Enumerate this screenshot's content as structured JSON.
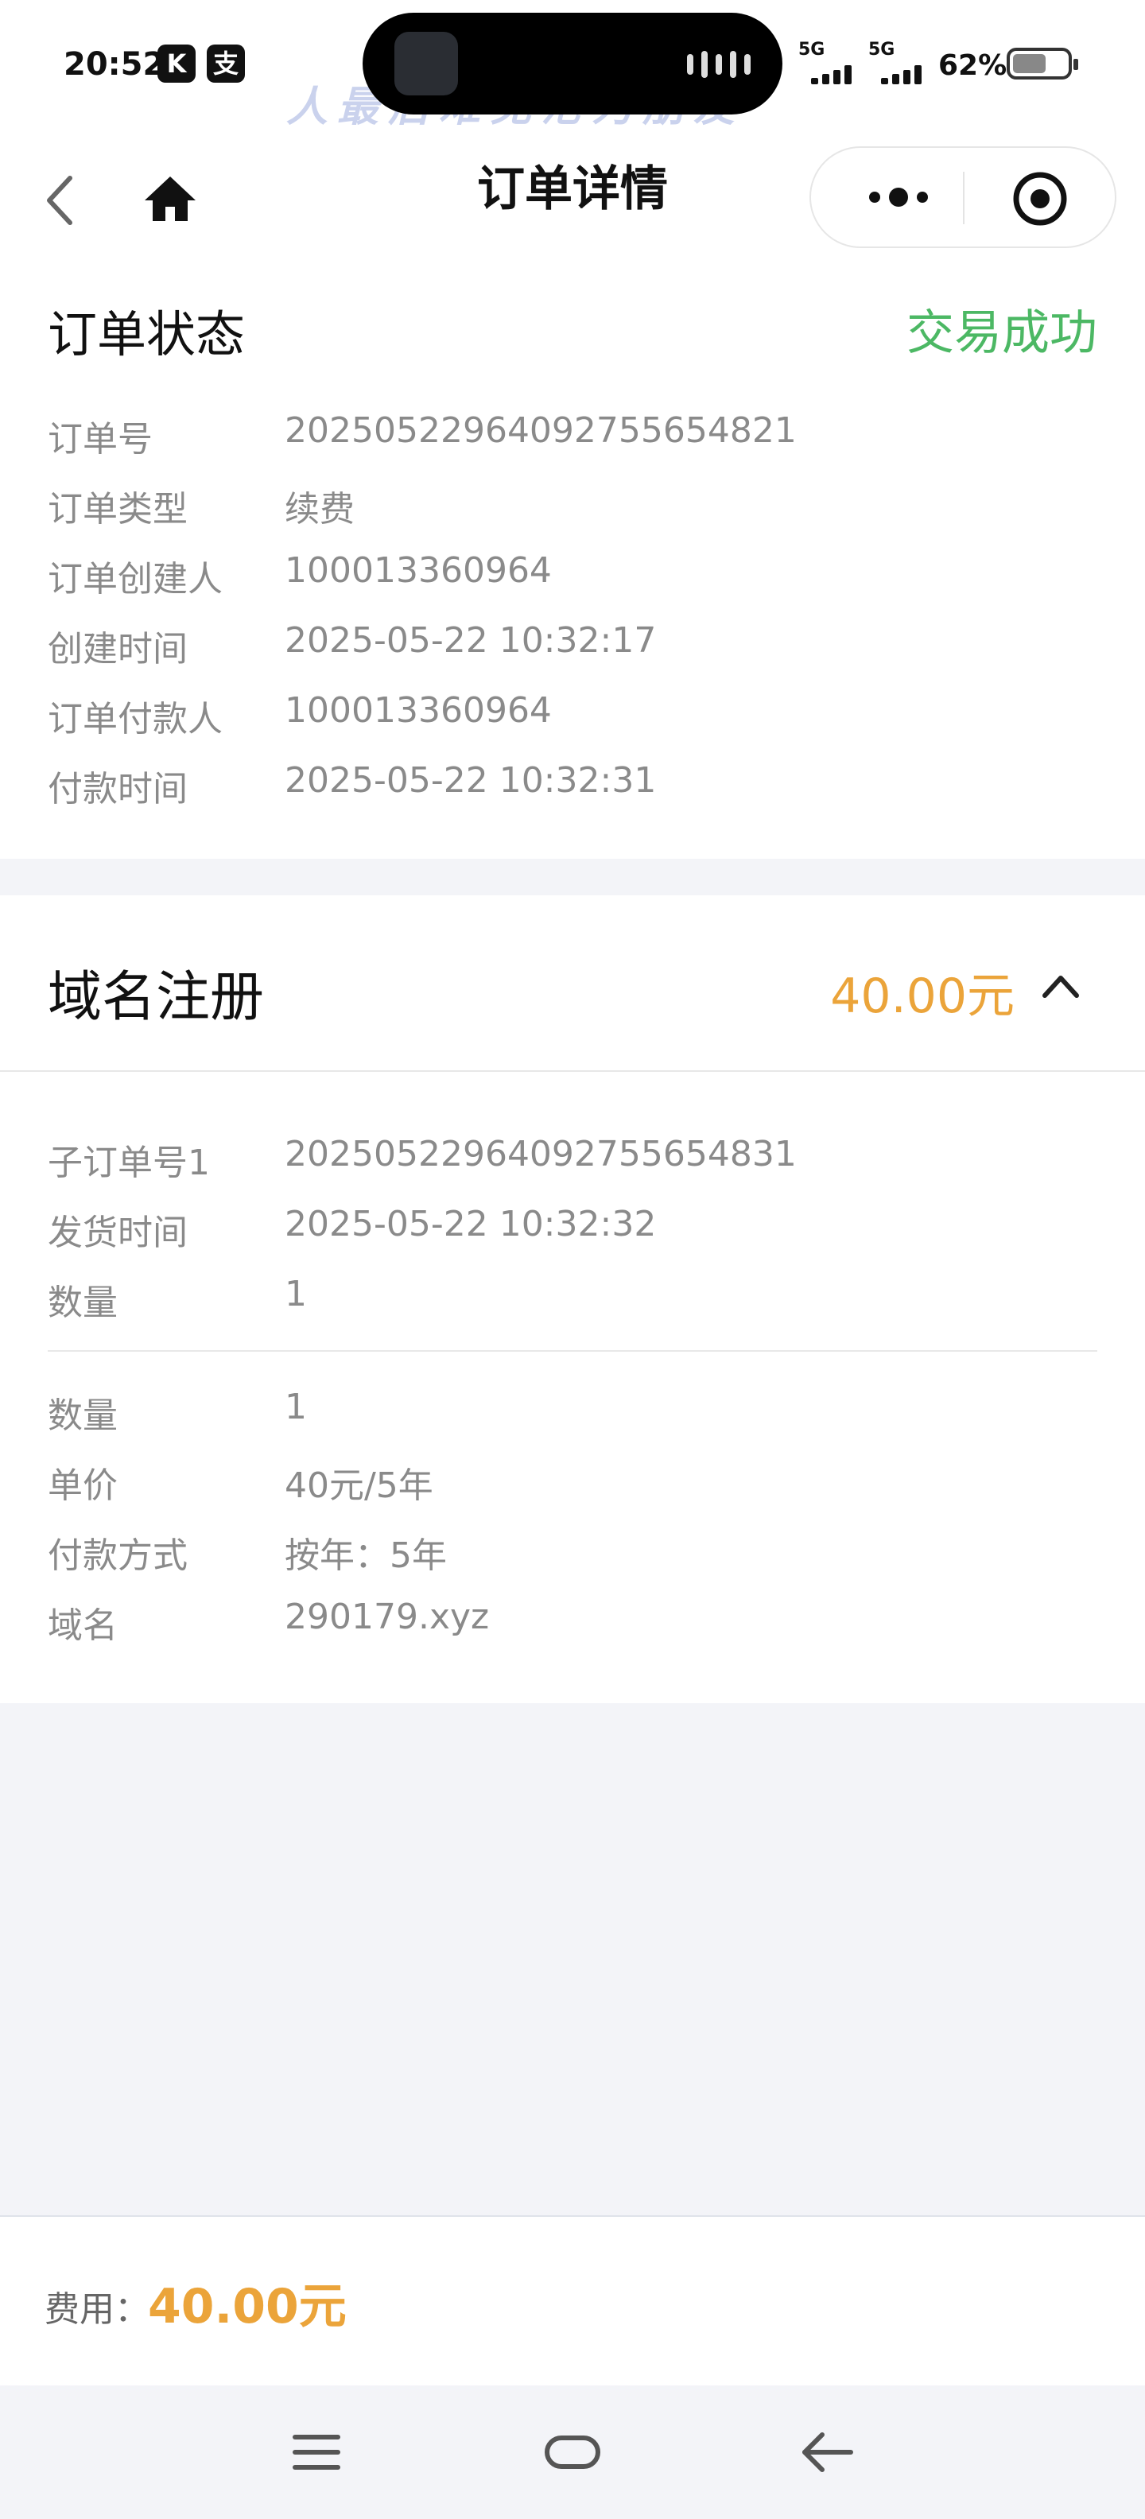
{
  "status_bar": {
    "time": "20:52",
    "app_icons": [
      "K",
      "支"
    ],
    "watermark": "人最后难免沦为朋友",
    "signal_1": "5G",
    "signal_2": "5G",
    "battery": "62%",
    "battery_level": 0.62
  },
  "nav": {
    "title": "订单详情"
  },
  "order_status": {
    "title": "订单状态",
    "status": "交易成功",
    "status_color": "#4cb864",
    "rows": [
      {
        "label": "订单号",
        "value": "20250522964092755654821"
      },
      {
        "label": "订单类型",
        "value": "续费"
      },
      {
        "label": "订单创建人",
        "value": "100013360964"
      },
      {
        "label": "创建时间",
        "value": "2025-05-22 10:32:17"
      },
      {
        "label": "订单付款人",
        "value": "100013360964"
      },
      {
        "label": "付款时间",
        "value": "2025-05-22 10:32:31"
      }
    ]
  },
  "domain_section": {
    "title": "域名注册",
    "price": "40.00元",
    "price_color": "#eba43a",
    "sub_rows": [
      {
        "label": "子订单号1",
        "value": "20250522964092755654831"
      },
      {
        "label": "发货时间",
        "value": "2025-05-22 10:32:32"
      },
      {
        "label": "数量",
        "value": "1"
      }
    ],
    "detail_rows": [
      {
        "label": "数量",
        "value": "1"
      },
      {
        "label": "单价",
        "value": "40元/5年"
      },
      {
        "label": "付款方式",
        "value": "按年：5年"
      },
      {
        "label": "域名",
        "value": "290179.xyz"
      }
    ]
  },
  "footer": {
    "fee_label": "费用：",
    "fee_value": "40.00元"
  },
  "icons": {
    "back": "chevron-left-icon",
    "home": "home-icon",
    "more": "more-dots-icon",
    "target": "target-icon",
    "collapse": "chevron-up-icon",
    "sys_menu": "menu-icon",
    "sys_home": "home-pill-icon",
    "sys_back": "arrow-left-icon"
  }
}
